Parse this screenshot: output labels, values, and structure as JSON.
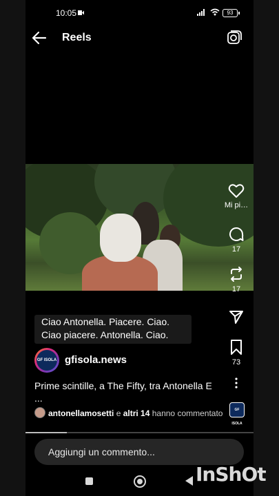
{
  "status_bar": {
    "time": "10:05",
    "battery": "93"
  },
  "header": {
    "title": "Reels"
  },
  "video": {
    "subtitle_lines": [
      "Ciao Antonella. Piacere. Ciao.",
      "Ciao piacere. Antonella. Ciao."
    ]
  },
  "actions": {
    "like_label": "Mi pi…",
    "comment_count": "17",
    "repost_count": "17",
    "save_count": "73"
  },
  "post": {
    "avatar_text": "GF ISOLA",
    "username": "gfisola.news",
    "description_line1": "Prime scintille, a The Fifty, tra Antonella E",
    "description_line2": "...",
    "commenters_name": "antonellamosetti",
    "commenters_rest": " e ",
    "commenters_others": "altri 14",
    "commenters_tail": " hanno commentato",
    "audio_badge": "GF ISOLA",
    "progress_fraction": 0.18
  },
  "comment": {
    "placeholder": "Aggiungi un commento..."
  },
  "watermark": "InShOt",
  "icons": [
    "back-arrow-icon",
    "camera-icon",
    "heart-icon",
    "comment-icon",
    "repost-icon",
    "send-icon",
    "bookmark-icon",
    "more-icon"
  ]
}
